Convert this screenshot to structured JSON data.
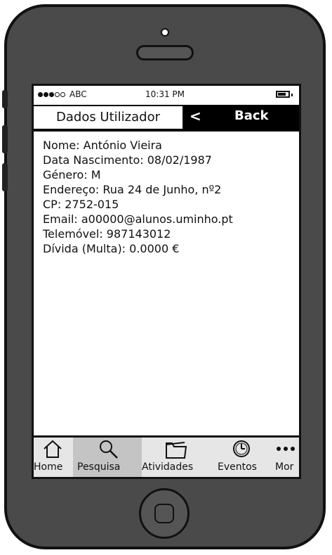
{
  "status": {
    "carrier": "ABC",
    "time": "10:31 PM"
  },
  "navbar": {
    "title": "Dados Utilizador",
    "back_chevron": "<",
    "back_label": "Back"
  },
  "profile": {
    "nome": "Nome: António Vieira",
    "data_nascimento": "Data Nascimento: 08/02/1987",
    "genero": "Género: M",
    "endereco": "Endereço: Rua 24 de Junho, nº2",
    "cp": "CP: 2752-015",
    "email": "Email: a00000@alunos.uminho.pt",
    "telemovel": "Telemóvel: 987143012",
    "divida": "Dívida (Multa): 0.0000 €"
  },
  "tabbar": {
    "items": [
      {
        "label": "Home",
        "icon": "home-icon"
      },
      {
        "label": "Pesquisa",
        "icon": "search-icon"
      },
      {
        "label": "Atividades",
        "icon": "folder-icon"
      },
      {
        "label": "Eventos",
        "icon": "clock-icon"
      },
      {
        "label": "Mor",
        "icon": "more-icon"
      }
    ],
    "selected": "Pesquisa"
  }
}
